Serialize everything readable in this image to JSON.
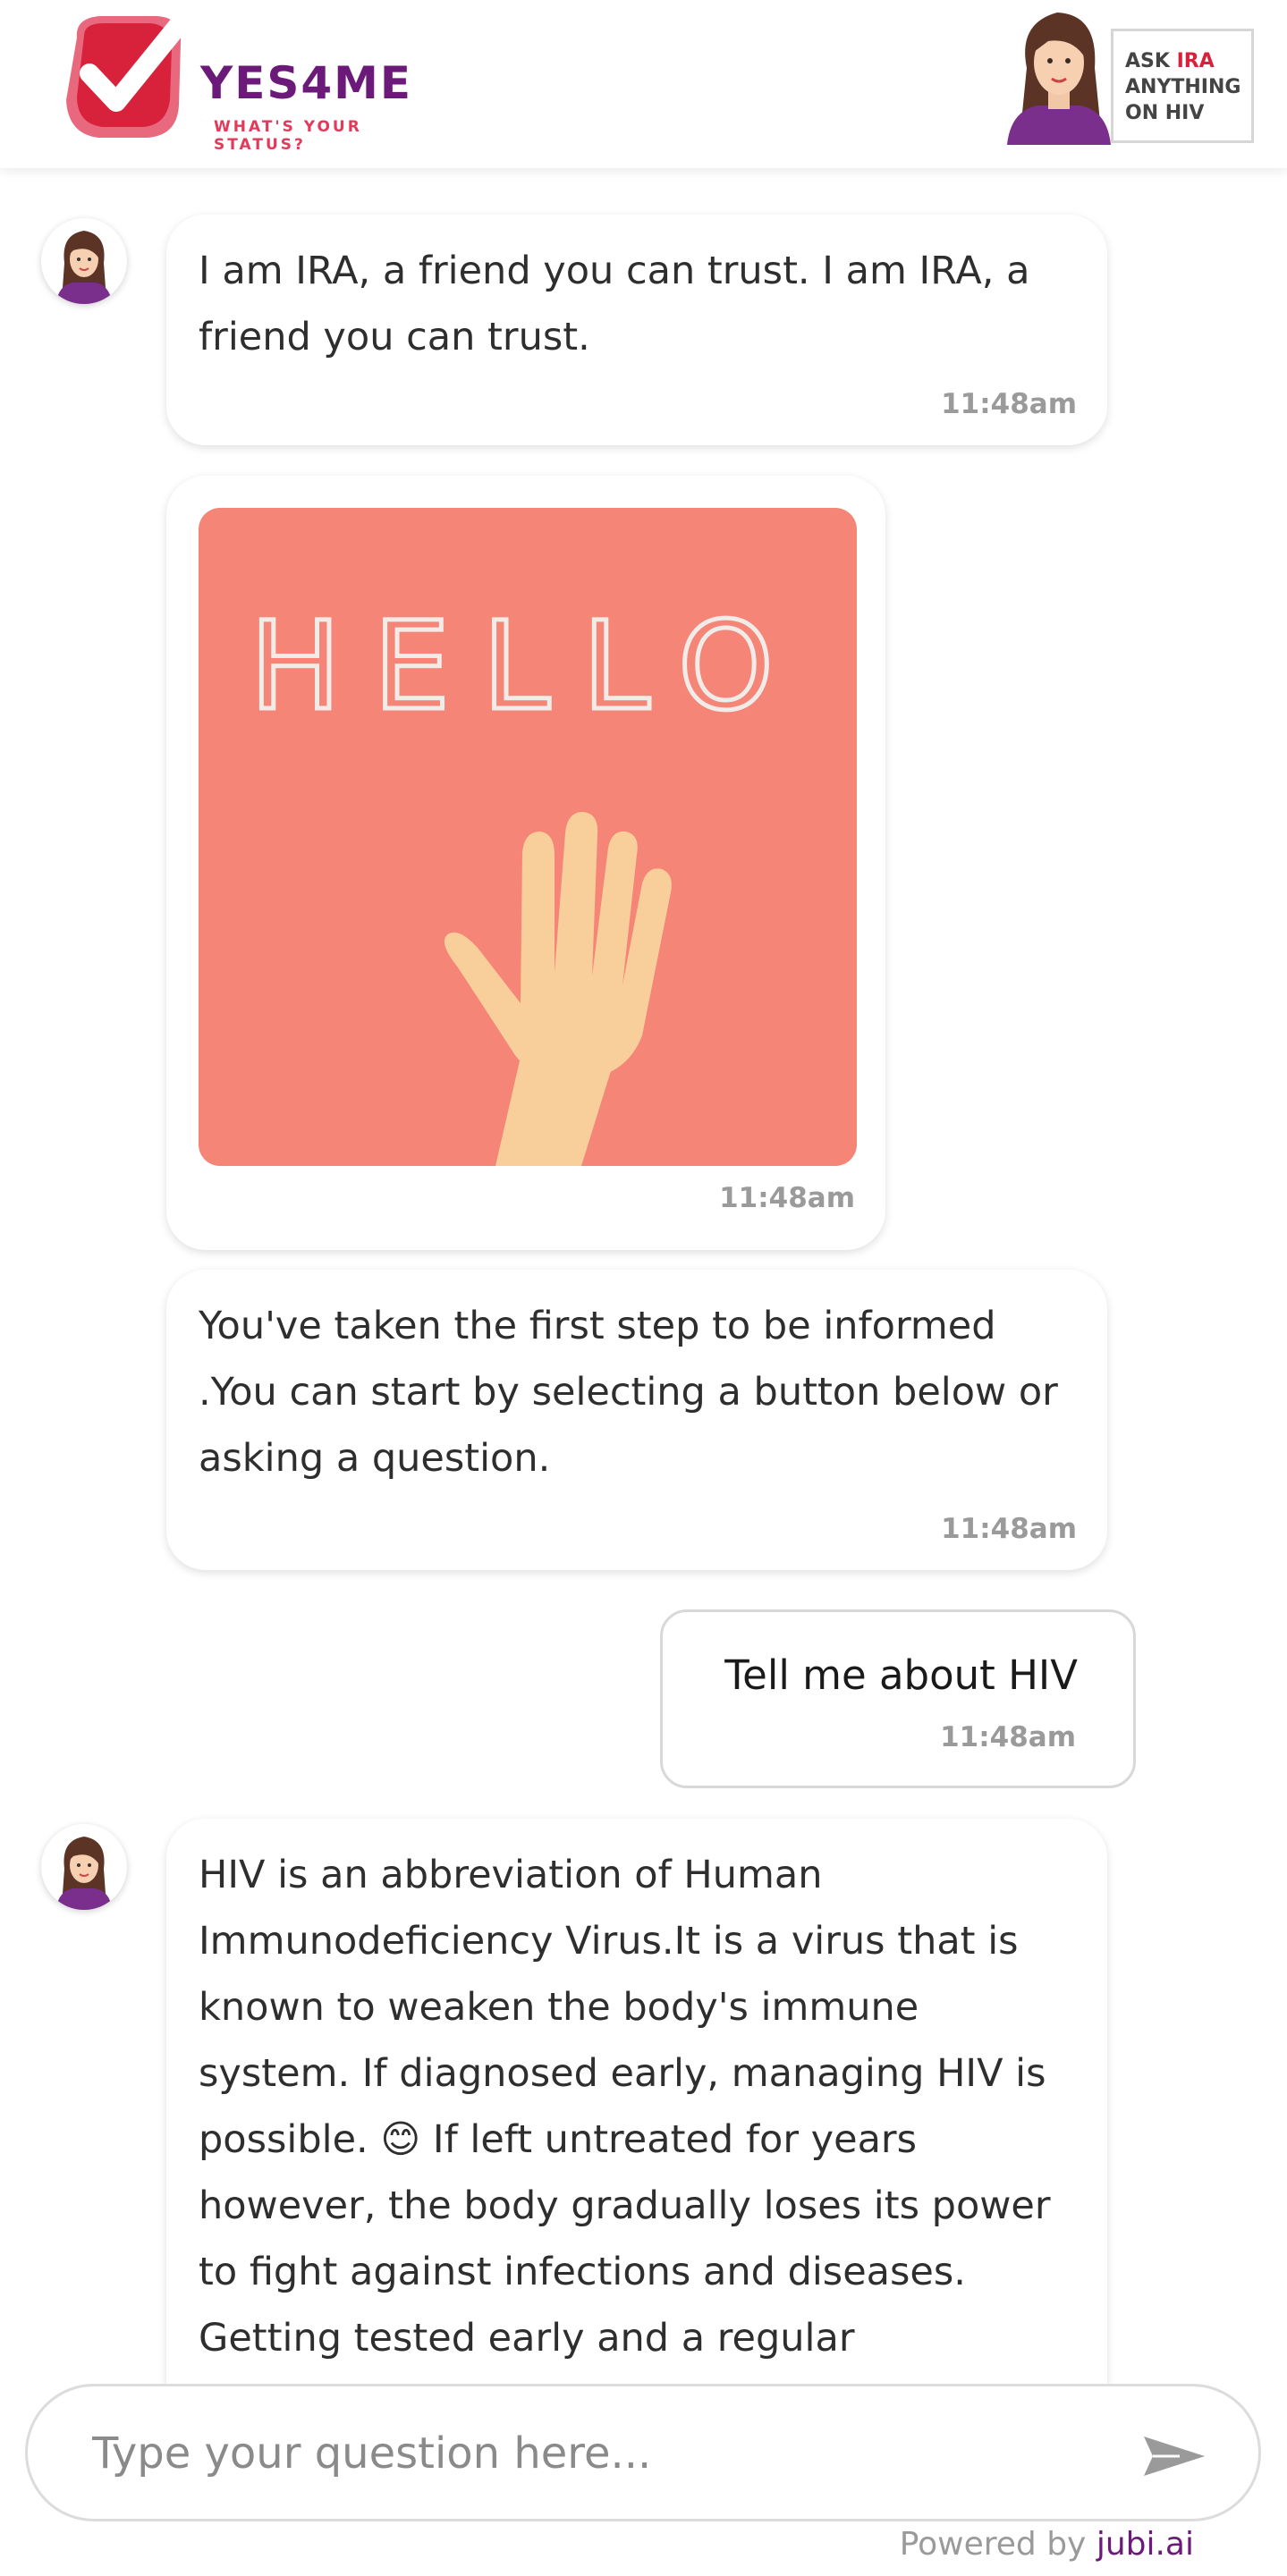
{
  "header": {
    "logo_brand": "YES4ME",
    "logo_tagline": "WHAT'S YOUR STATUS?",
    "ask_ira": {
      "line1_prefix": "ASK",
      "line1_highlight": "IRA",
      "line2": "ANYTHING",
      "line3": "ON HIV"
    }
  },
  "messages": [
    {
      "sender": "bot",
      "text": "I am IRA, a friend you can trust. I am IRA, a friend you can trust.",
      "time": "11:48am"
    },
    {
      "sender": "bot",
      "image_text": "HELLO",
      "time": "11:48am"
    },
    {
      "sender": "bot",
      "text": "You've taken the first step to be informed .You can start by selecting a button below or asking a question.",
      "time": "11:48am"
    },
    {
      "sender": "user",
      "text": "Tell me about HIV",
      "time": "11:48am"
    },
    {
      "sender": "bot",
      "text": "HIV is an abbreviation of Human Immunodeficiency Virus.It is a virus that is known to weaken the body's immune system. If diagnosed early, managing HIV is possible. 😊  If left untreated for years however, the body gradually loses its power to fight against infections and diseases. Getting tested early and a regular"
    }
  ],
  "input": {
    "placeholder": "Type your question here..."
  },
  "footer": {
    "powered_prefix": "Powered by",
    "powered_brand": "jubi.ai"
  },
  "colors": {
    "brand_purple": "#6c1a7a",
    "brand_red": "#e23a5a",
    "hello_card": "#f58577",
    "timestamp": "#9a9a9a"
  },
  "icons": [
    "checkmark-logo-icon",
    "ira-avatar-icon",
    "hand-wave-icon",
    "send-icon"
  ]
}
